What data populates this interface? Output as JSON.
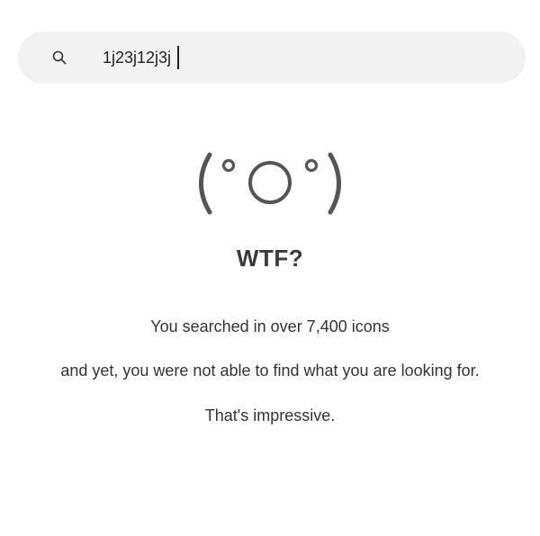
{
  "search": {
    "value": "1j23j12j3j",
    "icon": "search-icon"
  },
  "empty_state": {
    "face_icon": "surprised-face-icon",
    "heading": "WTF?",
    "line1": "You searched in over 7,400 icons",
    "line2": "and yet, you were not able to find what you are looking for.",
    "line3": "That's impressive."
  },
  "colors": {
    "search_bg": "#f2f2f2",
    "face_stroke": "#555555",
    "text": "#333333"
  }
}
